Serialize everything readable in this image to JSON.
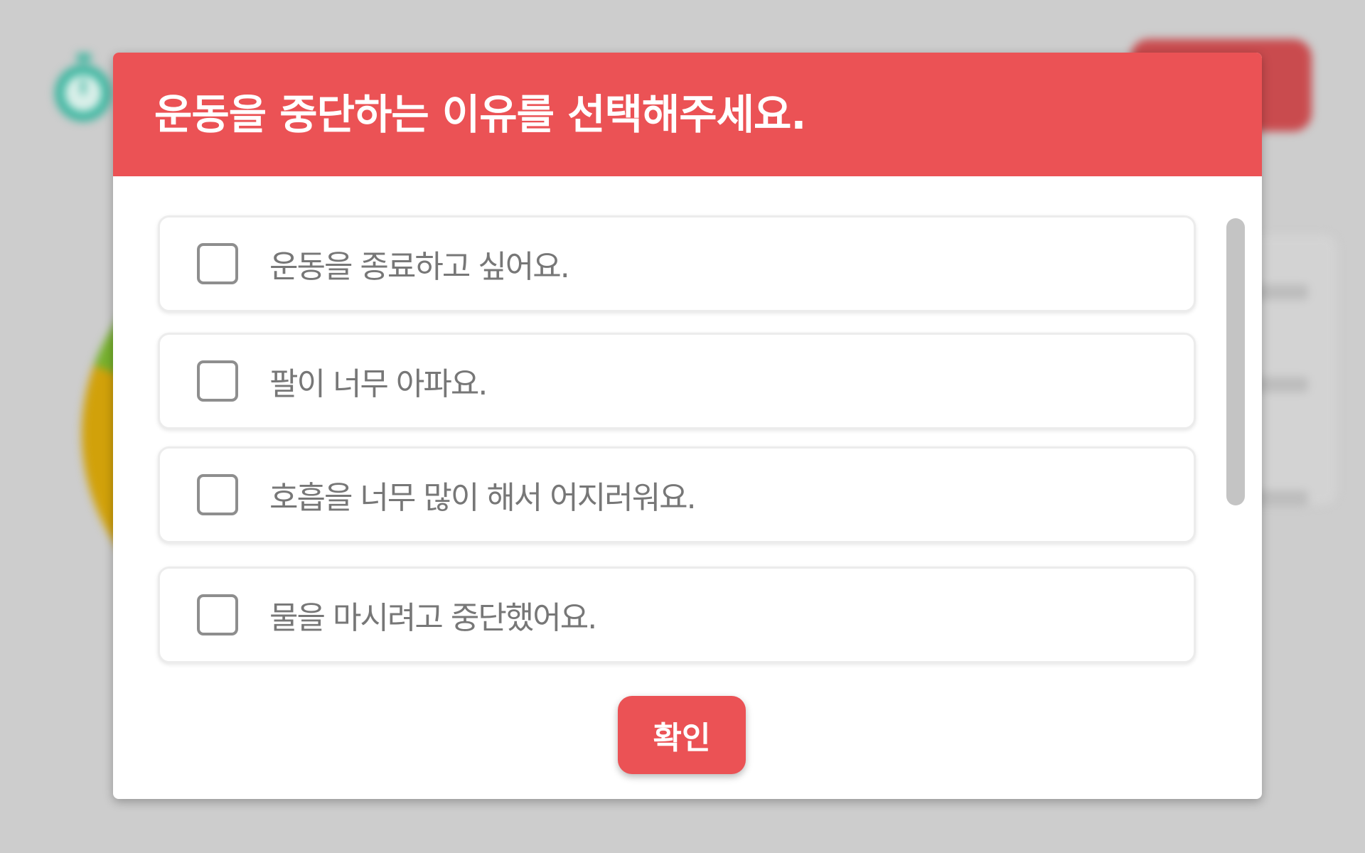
{
  "colors": {
    "accent": "#eb5255",
    "overlay_background": "#cdcdcd",
    "option_text": "#777777",
    "checkbox_border": "#8e8e8e"
  },
  "background": {
    "timer_icon": "stopwatch-icon"
  },
  "dialog": {
    "title": "운동을 중단하는 이유를 선택해주세요.",
    "options": [
      {
        "label": "운동을 종료하고 싶어요.",
        "checked": false
      },
      {
        "label": "팔이 너무 아파요.",
        "checked": false
      },
      {
        "label": "호흡을 너무 많이 해서 어지러워요.",
        "checked": false
      },
      {
        "label": "물을 마시려고 중단했어요.",
        "checked": false
      }
    ],
    "confirm_label": "확인"
  }
}
